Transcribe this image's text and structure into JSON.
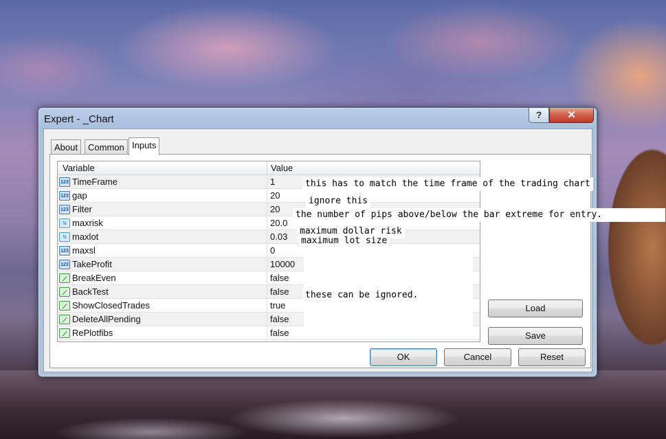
{
  "window": {
    "title": "Expert - _Chart",
    "help_glyph": "?",
    "close_glyph": "✕"
  },
  "tabs": [
    {
      "label": "About"
    },
    {
      "label": "Common"
    },
    {
      "label": "Inputs",
      "active": true
    }
  ],
  "table": {
    "headers": {
      "variable": "Variable",
      "value": "Value"
    },
    "rows": [
      {
        "variable": "TimeFrame",
        "value": "1",
        "icon": "int-type-icon",
        "icon_glyph": "123"
      },
      {
        "variable": "gap",
        "value": "20",
        "icon": "int-type-icon",
        "icon_glyph": "123"
      },
      {
        "variable": "Filter",
        "value": "20",
        "icon": "int-type-icon",
        "icon_glyph": "123"
      },
      {
        "variable": "maxrisk",
        "value": "20.0",
        "icon": "double-type-icon",
        "icon_glyph": "½"
      },
      {
        "variable": "maxlot",
        "value": "0.03",
        "icon": "double-type-icon",
        "icon_glyph": "½"
      },
      {
        "variable": "maxsl",
        "value": "0",
        "icon": "int-type-icon",
        "icon_glyph": "123"
      },
      {
        "variable": "TakeProfit",
        "value": "10000",
        "icon": "int-type-icon",
        "icon_glyph": "123"
      },
      {
        "variable": "BreakEven",
        "value": "false",
        "icon": "bool-type-icon",
        "icon_glyph": "⟋"
      },
      {
        "variable": "BackTest",
        "value": "false",
        "icon": "bool-type-icon",
        "icon_glyph": "⟋"
      },
      {
        "variable": "ShowClosedTrades",
        "value": "true",
        "icon": "bool-type-icon",
        "icon_glyph": "⟋"
      },
      {
        "variable": "DeleteAllPending",
        "value": "false",
        "icon": "bool-type-icon",
        "icon_glyph": "⟋"
      },
      {
        "variable": "RePlotfibs",
        "value": "false",
        "icon": "bool-type-icon",
        "icon_glyph": "⟋"
      }
    ]
  },
  "annotations": {
    "timeframe": "this has to match the time frame of the trading chart",
    "gap": "ignore this",
    "filter": "the number of pips above/below the bar extreme for entry.",
    "maxrisk": "maximum dollar risk",
    "maxlot": "maximum lot size",
    "ignored": "these can be ignored."
  },
  "buttons": {
    "load": "Load",
    "save": "Save",
    "ok": "OK",
    "cancel": "Cancel",
    "reset": "Reset"
  }
}
